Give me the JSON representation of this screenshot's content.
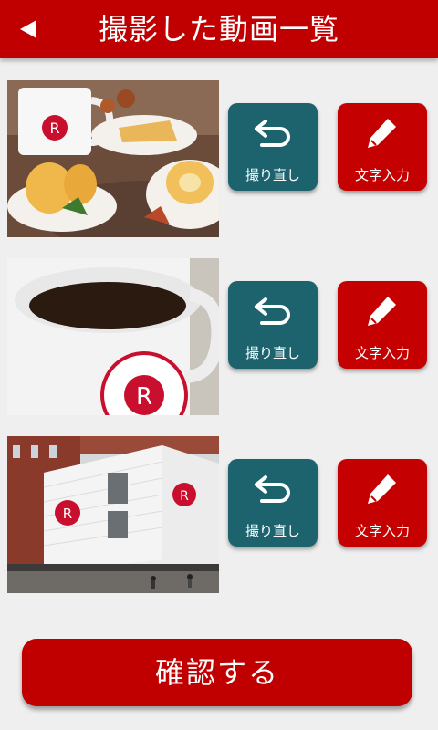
{
  "header": {
    "title": "撮影した動画一覧",
    "back_icon": "back-arrow-icon"
  },
  "videos": [
    {
      "subject": "cafe-dessert-plates",
      "retake_label": "撮り直し",
      "text_label": "文字入力"
    },
    {
      "subject": "coffee-mug",
      "retake_label": "撮り直し",
      "text_label": "文字入力"
    },
    {
      "subject": "cafe-building",
      "retake_label": "撮り直し",
      "text_label": "文字入力"
    }
  ],
  "confirm_label": "確認する",
  "colors": {
    "header": "#c00000",
    "retake": "#1c636e",
    "text_input": "#c40000",
    "background": "#efefef"
  }
}
